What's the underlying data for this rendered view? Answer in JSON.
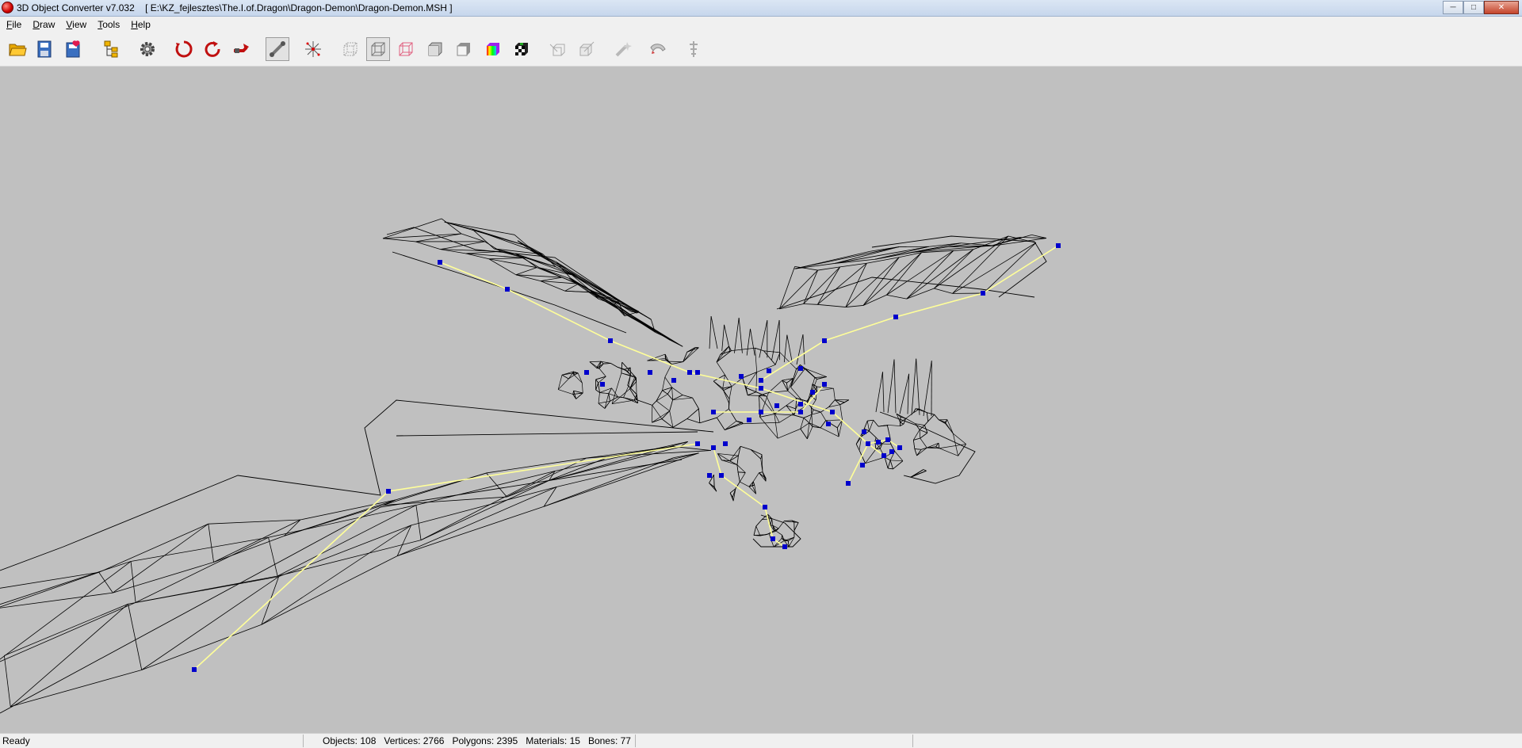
{
  "window": {
    "app_title": "3D Object Converter v7.032",
    "file_path": "[ E:\\KZ_fejlesztes\\The.I.of.Dragon\\Dragon-Demon\\Dragon-Demon.MSH ]",
    "minimize_icon": "minimize-icon",
    "maximize_icon": "maximize-icon",
    "close_icon": "close-icon"
  },
  "menu": {
    "file": "File",
    "draw": "Draw",
    "view": "View",
    "tools": "Tools",
    "help": "Help"
  },
  "toolbar": [
    {
      "id": "open",
      "icon": "open-folder-icon"
    },
    {
      "id": "save",
      "icon": "save-icon"
    },
    {
      "id": "save-as",
      "icon": "save-as-icon"
    },
    {
      "id": "hierarchy",
      "icon": "hierarchy-icon"
    },
    {
      "id": "settings",
      "icon": "gear-icon"
    },
    {
      "id": "rotate-x",
      "icon": "rotate-x-icon"
    },
    {
      "id": "rotate-y",
      "icon": "rotate-y-icon"
    },
    {
      "id": "rotate-z",
      "icon": "rotate-z-icon"
    },
    {
      "id": "bones",
      "icon": "bones-icon",
      "pressed": true
    },
    {
      "id": "vertices",
      "icon": "vertices-icon"
    },
    {
      "id": "bounding-box",
      "icon": "bounding-box-icon"
    },
    {
      "id": "wireframe",
      "icon": "wireframe-icon",
      "pressed": true
    },
    {
      "id": "wireframe-red",
      "icon": "wireframe-red-icon"
    },
    {
      "id": "flat-shading",
      "icon": "flat-shading-icon"
    },
    {
      "id": "smooth-shading",
      "icon": "smooth-shading-icon"
    },
    {
      "id": "vertex-colors",
      "icon": "vertex-colors-icon"
    },
    {
      "id": "textures",
      "icon": "textures-icon"
    },
    {
      "id": "normals-out",
      "icon": "normals-out-icon"
    },
    {
      "id": "normals-in",
      "icon": "normals-in-icon"
    },
    {
      "id": "tool-a",
      "icon": "wand-icon"
    },
    {
      "id": "tool-b",
      "icon": "magnet-icon"
    },
    {
      "id": "tool-c",
      "icon": "tree-icon"
    }
  ],
  "status": {
    "ready": "Ready",
    "objects": "Objects: 108",
    "vertices": "Vertices: 2766",
    "polygons": "Polygons: 2395",
    "materials": "Materials: 15",
    "bones": "Bones: 77"
  },
  "colors": {
    "viewport_bg": "#c0c0c0",
    "wire": "#000000",
    "bone": "#ffff99",
    "bone_joint": "#0000cc"
  }
}
